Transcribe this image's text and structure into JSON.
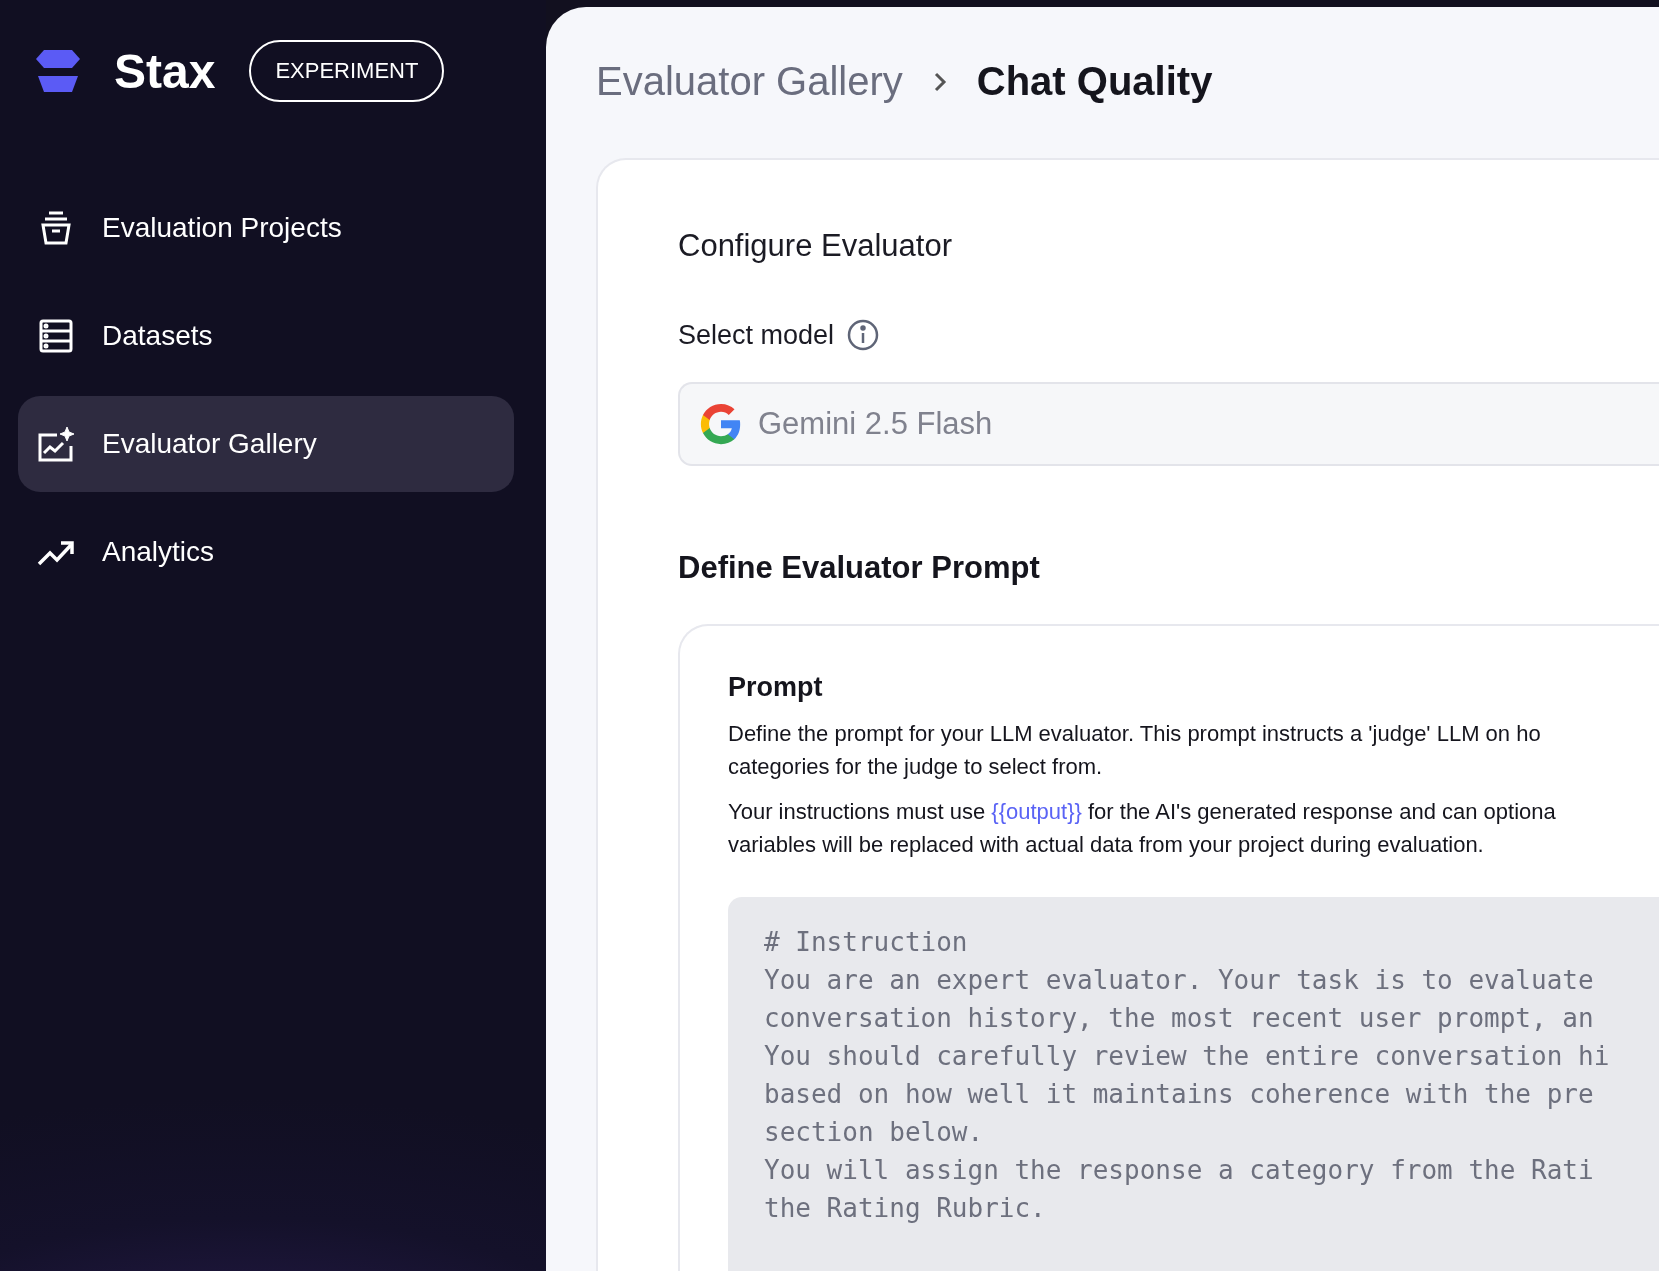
{
  "sidebar": {
    "brand": "Stax",
    "badge": "EXPERIMENT",
    "items": [
      {
        "label": "Evaluation Projects",
        "kind": "box",
        "selected": false
      },
      {
        "label": "Datasets",
        "kind": "list",
        "selected": false
      },
      {
        "label": "Evaluator Gallery",
        "kind": "gallery",
        "selected": true
      },
      {
        "label": "Analytics",
        "kind": "trend",
        "selected": false
      }
    ]
  },
  "breadcrumb": [
    {
      "label": "Evaluator Gallery",
      "current": false
    },
    {
      "label": "Chat Quality",
      "current": true
    }
  ],
  "configure": {
    "title": "Configure Evaluator",
    "model_label": "Select model",
    "model_value": "Gemini 2.5 Flash"
  },
  "prompt_section": {
    "title": "Define Evaluator Prompt",
    "card_title": "Prompt",
    "paragraphs": [
      "Define the prompt for your LLM evaluator. This prompt instructs a 'judge' LLM on ho\ncategories for the judge to select from.",
      "Your instructions must use {{output}} for the AI's generated response and can optiona\nvariables will be replaced with actual data from your project during evaluation."
    ],
    "code_lines": [
      "# Instruction",
      "You are an expert evaluator. Your task is to evaluate",
      "conversation history, the most recent user prompt, an",
      "You should carefully review the entire conversation hi",
      "based on how well it maintains coherence with the pre",
      "section below.",
      "You will assign the response a category from the Rati",
      "the Rating Rubric."
    ]
  }
}
